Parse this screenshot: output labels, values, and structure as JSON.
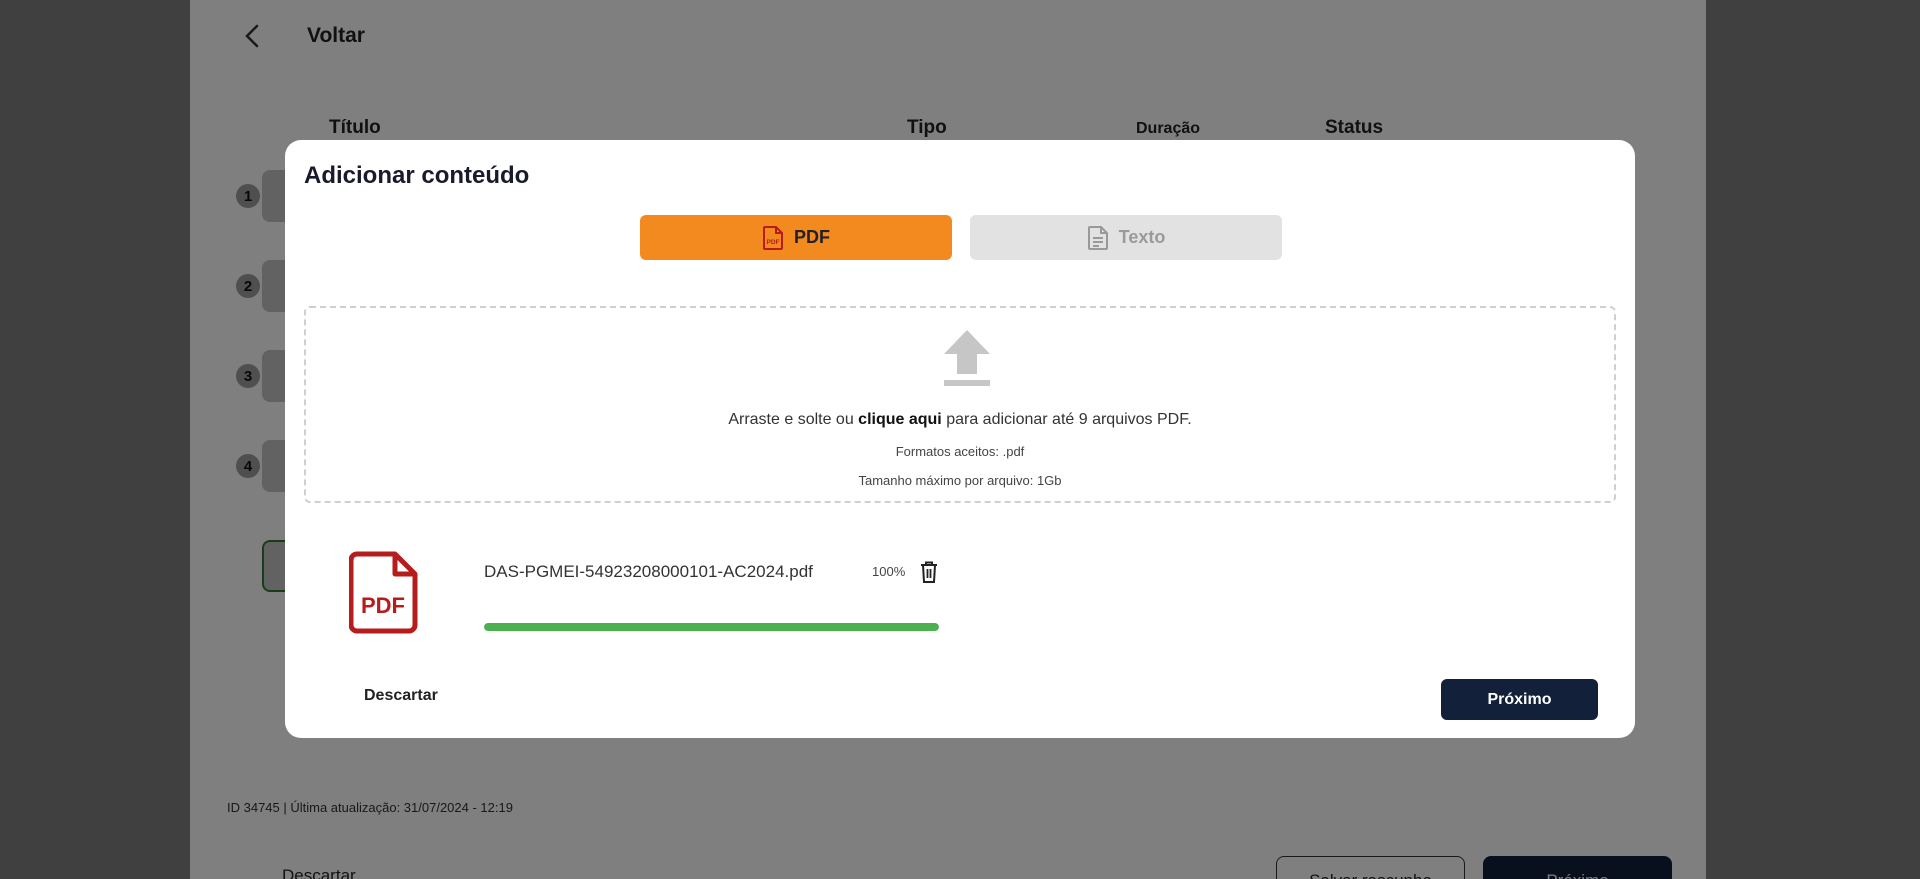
{
  "background": {
    "back_label": "Voltar",
    "columns": {
      "title": "Título",
      "type": "Tipo",
      "duration": "Duração",
      "status": "Status"
    },
    "rows": [
      "1",
      "2",
      "3",
      "4"
    ],
    "footer_id": "ID 34745 | Última atualização: 31/07/2024 - 12:19",
    "discard_label": "Descartar",
    "save_draft_label": "Salvar rascunho",
    "next_label": "Próximo"
  },
  "modal": {
    "title": "Adicionar conteúdo",
    "tabs": [
      {
        "label": "PDF",
        "icon": "pdf-file-icon",
        "active": true
      },
      {
        "label": "Texto",
        "icon": "text-file-icon",
        "active": false
      }
    ],
    "dropzone": {
      "icon": "upload-icon",
      "text_before": "Arraste e solte ou ",
      "text_link": "clique aqui",
      "text_after": " para adicionar até 9 arquivos PDF.",
      "formats": "Formatos aceitos: .pdf",
      "max_size": "Tamanho máximo por arquivo: 1Gb"
    },
    "file": {
      "icon": "pdf-icon",
      "name": "DAS-PGMEI-54923208000101-AC2024.pdf",
      "progress_label": "100%",
      "progress": 1.0
    },
    "discard_label": "Descartar",
    "next_label": "Próximo"
  },
  "colors": {
    "accent": "#f28a1f",
    "primary": "#13203a",
    "progress": "#4caf50",
    "pdf_red": "#b71c1c"
  }
}
